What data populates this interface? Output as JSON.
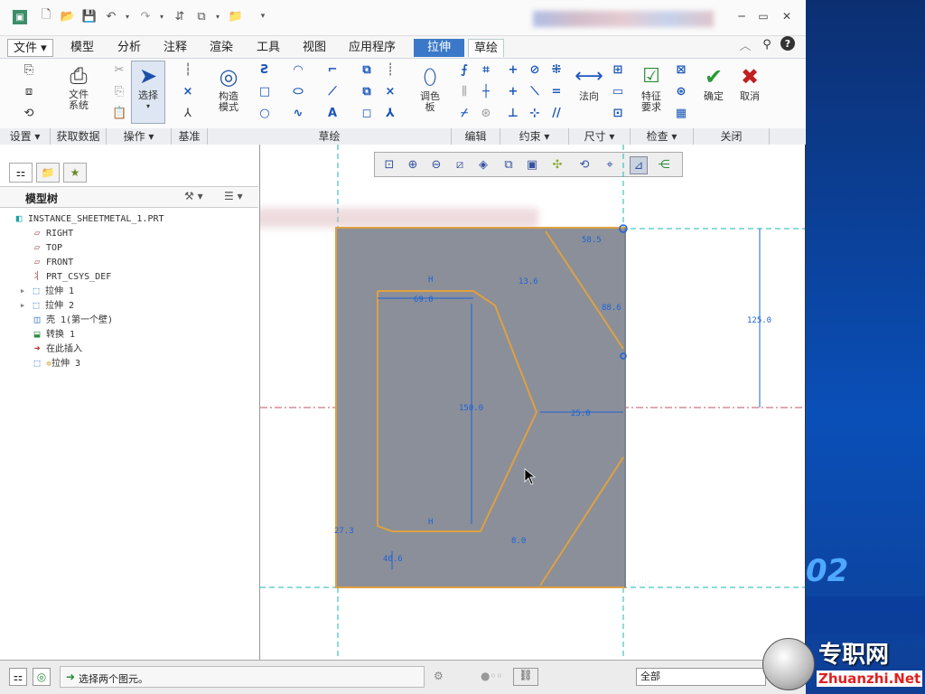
{
  "tabs": [
    "文件",
    "模型",
    "分析",
    "注释",
    "渲染",
    "工具",
    "视图",
    "应用程序",
    "拉伸",
    "草绘"
  ],
  "ribbon": {
    "file_system": "文件\n系统",
    "select": "选择",
    "construct_mode": "构造\n模式",
    "palette": "调色\n板",
    "normal": "法向",
    "feature_req": "特征\n要求",
    "confirm": "确定",
    "cancel": "取消",
    "groups": [
      "设置",
      "获取数据",
      "操作",
      "基准",
      "草绘",
      "编辑",
      "约束",
      "尺寸",
      "检查",
      "关闭"
    ]
  },
  "model_tree": {
    "title": "模型树",
    "items": [
      {
        "label": "INSTANCE_SHEETMETAL_1.PRT",
        "icon": "part-icon"
      },
      {
        "label": "RIGHT",
        "icon": "plane-icon"
      },
      {
        "label": "TOP",
        "icon": "plane-icon"
      },
      {
        "label": "FRONT",
        "icon": "plane-icon"
      },
      {
        "label": "PRT_CSYS_DEF",
        "icon": "csys-icon"
      },
      {
        "label": "拉伸 1",
        "icon": "extrude-icon"
      },
      {
        "label": "拉伸 2",
        "icon": "extrude-icon"
      },
      {
        "label": "壳 1(第一个壁)",
        "icon": "shell-icon"
      },
      {
        "label": "转换 1",
        "icon": "convert-icon"
      },
      {
        "label": "在此插入",
        "icon": "insert-arrow-icon"
      },
      {
        "label": "拉伸 3",
        "icon": "extrude-icon"
      }
    ]
  },
  "sketch": {
    "dims": [
      "58.5",
      "13.6",
      "69.0",
      "88.6",
      "125.0",
      "150.0",
      "25.0",
      "8.0",
      "40.6",
      "27.3"
    ],
    "right_label": "RIGHT",
    "hv": "H"
  },
  "status": {
    "message": "选择两个图元。",
    "filter": "全部"
  },
  "watermark": {
    "brand": "专职网",
    "url": "Zhuanzhi.Net",
    "num": "02"
  },
  "colors": {
    "accent": "#3b79c8",
    "sketch_line": "#e0a040",
    "dim": "#1d63d6",
    "model_gray": "#8a8f9a"
  }
}
